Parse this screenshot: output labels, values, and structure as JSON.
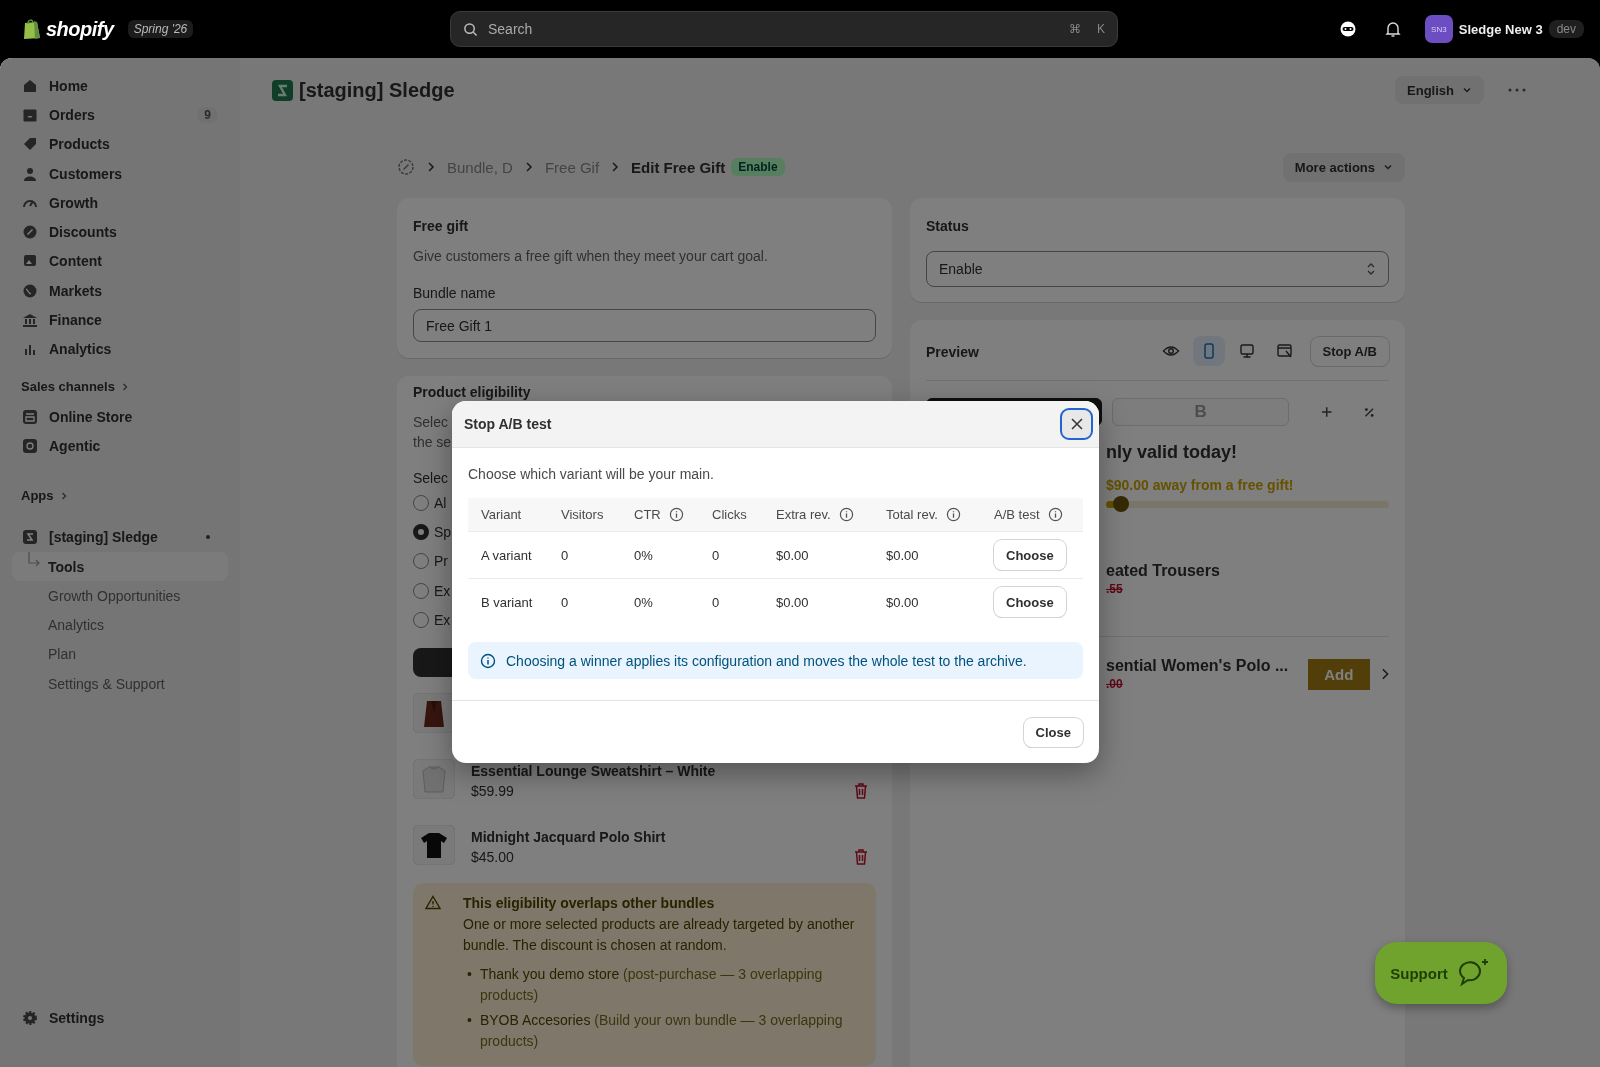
{
  "topbar": {
    "brand": "shopify",
    "edition": "Spring '26",
    "search": {
      "placeholder": "Search",
      "shortcut": [
        "⌘",
        "K"
      ]
    },
    "account": {
      "initials": "SN3",
      "name": "Sledge New 3",
      "tag": "dev"
    }
  },
  "sidebar": {
    "items": [
      {
        "label": "Home"
      },
      {
        "label": "Orders",
        "count": "9"
      },
      {
        "label": "Products"
      },
      {
        "label": "Customers"
      },
      {
        "label": "Growth"
      },
      {
        "label": "Discounts"
      },
      {
        "label": "Content"
      },
      {
        "label": "Markets"
      },
      {
        "label": "Finance"
      },
      {
        "label": "Analytics"
      }
    ],
    "sales_channels": {
      "title": "Sales channels",
      "items": [
        {
          "label": "Online Store"
        },
        {
          "label": "Agentic"
        }
      ]
    },
    "apps": {
      "title": "Apps",
      "app": {
        "label": "[staging] Sledge",
        "children": [
          {
            "label": "Tools",
            "selected": true
          },
          {
            "label": "Growth Opportunities",
            "selected": false
          },
          {
            "label": "Analytics",
            "selected": false
          },
          {
            "label": "Plan",
            "selected": false
          },
          {
            "label": "Settings & Support",
            "selected": false
          }
        ]
      }
    },
    "settings": {
      "label": "Settings"
    }
  },
  "header": {
    "title": "[staging] Sledge",
    "language": "English"
  },
  "breadcrumb": {
    "items": [
      "Bundle, D",
      "Free Gif"
    ],
    "current": "Edit Free Gift",
    "badge": "Enable",
    "more_actions": "More actions"
  },
  "free_gift": {
    "title": "Free gift",
    "description": "Give customers a free gift when they meet your cart goal.",
    "field": {
      "label": "Bundle name",
      "value": "Free Gift 1"
    }
  },
  "eligibility": {
    "title": "Product eligibility",
    "description": [
      "Selec",
      "the se"
    ],
    "select_label": "Selec",
    "options": [
      {
        "label": "Al",
        "selected": false
      },
      {
        "label": "Sp",
        "selected": true
      },
      {
        "label": "Pr",
        "selected": false
      },
      {
        "label": "Ex",
        "selected": false
      },
      {
        "label": "Ex",
        "selected": false
      }
    ],
    "products": [
      {
        "kind": "picture"
      },
      {
        "kind": "picture",
        "name": "Essential Lounge Sweatshirt – White",
        "price": "$59.99"
      },
      {
        "kind": "picture",
        "name": "Midnight Jacquard Polo Shirt",
        "price": "$45.00"
      }
    ],
    "warning": {
      "title": "This eligibility overlaps other bundles",
      "body": "One or more selected products are already targeted by another bundle. The discount is chosen at random.",
      "bullets": [
        {
          "marker": "•",
          "name": "Thank you demo store",
          "detail": "(post-purchase — 3 overlapping products)"
        },
        {
          "marker": "•",
          "name": "BYOB Accesories",
          "detail": "(Build your own bundle — 3 overlapping products)"
        }
      ]
    }
  },
  "status": {
    "title": "Status",
    "value": "Enable"
  },
  "preview": {
    "title": "Preview",
    "views": [
      {
        "selected": false
      },
      {
        "selected": true
      },
      {
        "selected": false
      },
      {
        "selected": false
      }
    ],
    "stop_button": "Stop A/B",
    "variants": [
      {
        "selected": true
      },
      {
        "label": "B",
        "selected": false
      }
    ],
    "headline": "nly valid today!",
    "goal": {
      "text": "$90.00 away from a free gift!",
      "level": 0.04
    },
    "items": [
      {
        "name": "eated Trousers",
        "old_price": ".55"
      },
      {
        "name": "sential Women's Polo ...",
        "old_price": ".00",
        "button": "Add"
      }
    ]
  },
  "support": {
    "label": "Support"
  },
  "modal": {
    "title": "Stop A/B test",
    "intro": "Choose which variant will be your main.",
    "columns": [
      {
        "label": "Variant",
        "info": false
      },
      {
        "label": "Visitors",
        "info": false
      },
      {
        "label": "CTR",
        "info": true
      },
      {
        "label": "Clicks",
        "info": false
      },
      {
        "label": "Extra rev.",
        "info": true
      },
      {
        "label": "Total rev.",
        "info": true
      },
      {
        "label": "A/B test",
        "info": true
      }
    ],
    "rows": [
      {
        "cells": [
          "A variant",
          "0",
          "0%",
          "0",
          "$0.00",
          "$0.00"
        ],
        "action": "Choose"
      },
      {
        "cells": [
          "B variant",
          "0",
          "0%",
          "0",
          "$0.00",
          "$0.00"
        ],
        "action": "Choose"
      }
    ],
    "notice": "Choosing a winner applies its configuration and moves the whole test to the archive.",
    "close": "Close"
  }
}
